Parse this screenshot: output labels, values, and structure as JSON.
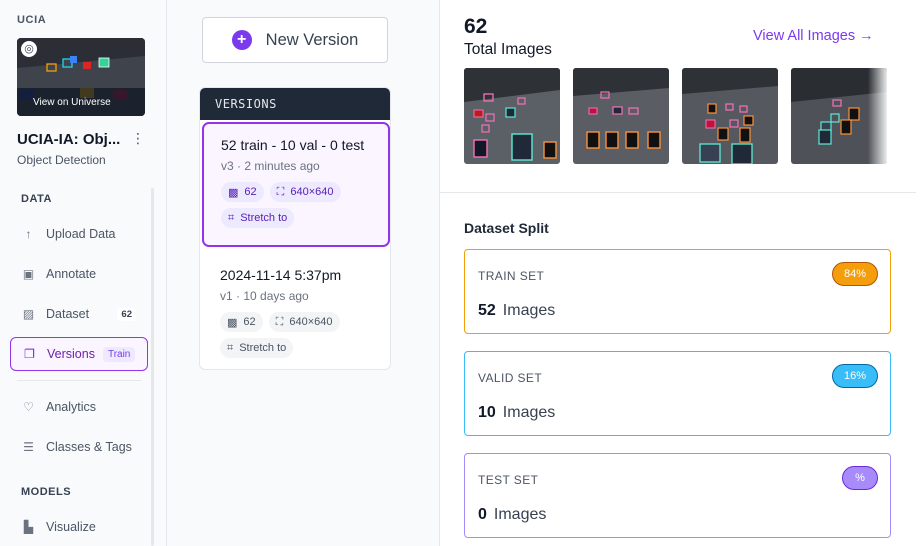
{
  "sidebar": {
    "workspace": "UCIA",
    "thumbnail_caption": "View on Universe",
    "project_title": "UCIA-IA: Obj...",
    "project_type": "Object Detection",
    "sections": {
      "data": "DATA",
      "models": "MODELS"
    },
    "items": [
      {
        "label": "Upload Data",
        "icon": "upload-icon"
      },
      {
        "label": "Annotate",
        "icon": "annotate-icon"
      },
      {
        "label": "Dataset",
        "icon": "dataset-icon",
        "count": "62"
      },
      {
        "label": "Versions",
        "icon": "versions-icon",
        "tag": "Train",
        "active": true
      },
      {
        "label": "Analytics",
        "icon": "analytics-icon"
      },
      {
        "label": "Classes & Tags",
        "icon": "classes-icon"
      },
      {
        "label": "Visualize",
        "icon": "visualize-icon"
      }
    ]
  },
  "versions": {
    "new_button": "New Version",
    "header": "VERSIONS",
    "list": [
      {
        "title": "52 train - 10 val - 0 test",
        "meta": "v3 · 2 minutes ago",
        "images": "62",
        "size": "640×640",
        "resize": "Stretch to",
        "selected": true
      },
      {
        "title": "2024-11-14 5:37pm",
        "meta": "v1 · 10 days ago",
        "images": "62",
        "size": "640×640",
        "resize": "Stretch to",
        "selected": false
      }
    ]
  },
  "summary": {
    "total_count": "62",
    "total_label": "Total Images",
    "view_all": "View All Images →"
  },
  "split": {
    "title": "Dataset Split",
    "train": {
      "name": "TRAIN SET",
      "percent": "84%",
      "count": "52",
      "unit": "Images",
      "color": "#f59e0b"
    },
    "valid": {
      "name": "VALID SET",
      "percent": "16%",
      "count": "10",
      "unit": "Images",
      "color": "#38bdf8"
    },
    "test": {
      "name": "TEST SET",
      "percent": "%",
      "count": "0",
      "unit": "Images",
      "color": "#a78bfa"
    }
  },
  "colors": {
    "accent": "#7c3aed",
    "sidebar_bg": "#f8fafc",
    "header_dark": "#1f2937"
  }
}
